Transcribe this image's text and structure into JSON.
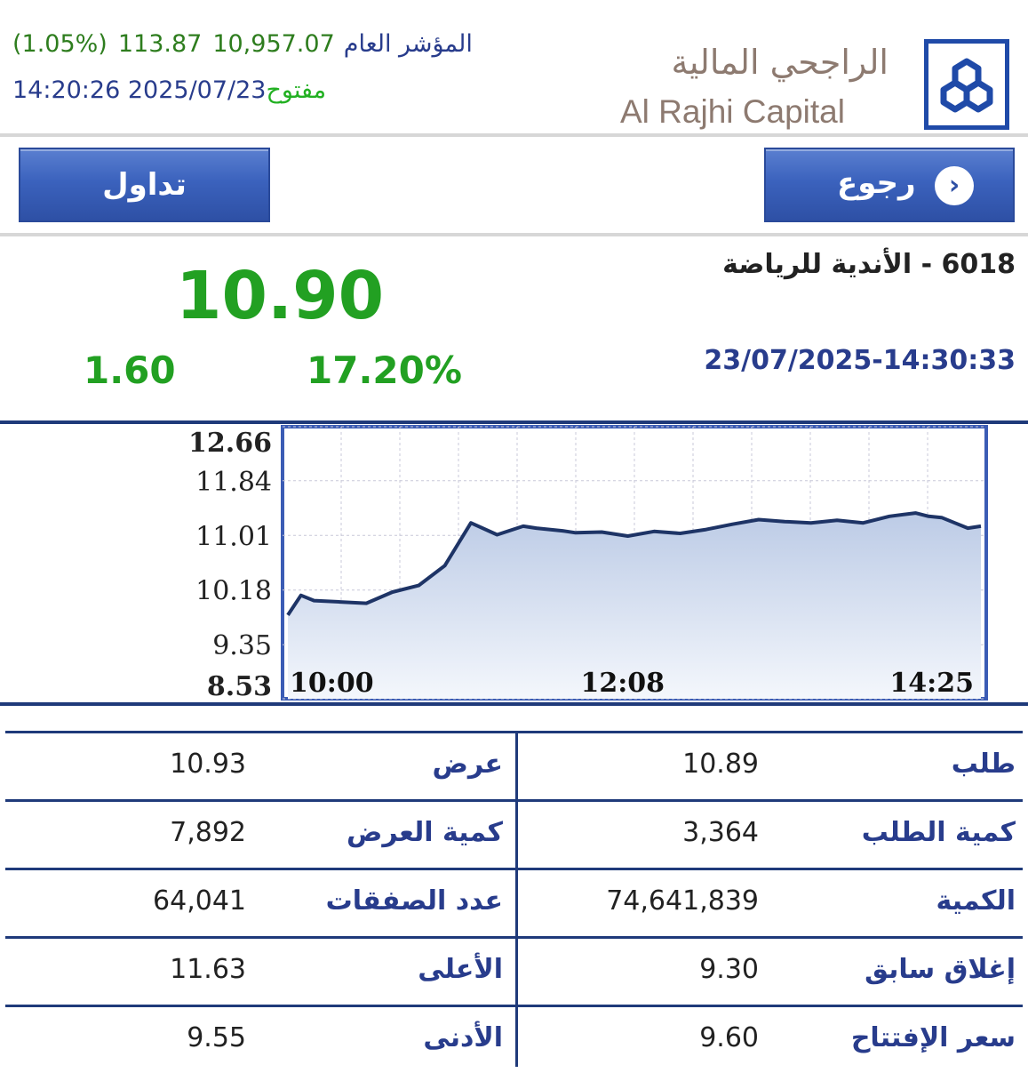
{
  "header": {
    "index_label": "المؤشر العام",
    "index_value": "10,957.07",
    "index_change": "113.87",
    "index_change_pct": "(1.05%)",
    "date_time": "2025/07/23 14:20:26",
    "market_status": "مفتوح",
    "brand_ar": "الراجحي المالية",
    "brand_en": "Al Rajhi Capital"
  },
  "nav": {
    "back_label": "رجوع",
    "back_icon": "chevron-right-icon",
    "trade_label": "تداول"
  },
  "stock": {
    "name": "6018 - الأندية للرياضة",
    "timestamp": "23/07/2025-14:30:33",
    "price": "10.90",
    "change": "1.60",
    "change_pct": "17.20%"
  },
  "colors": {
    "up": "#22a022",
    "navy": "#1f3a7a",
    "label": "#283c8c",
    "status_open": "#22b022"
  },
  "chart_data": {
    "type": "area",
    "y_ticks": [
      "12.66",
      "11.84",
      "11.01",
      "10.18",
      "9.35",
      "8.53"
    ],
    "x_ticks": [
      "10:00",
      "12:08",
      "14:25"
    ],
    "ylim": [
      8.53,
      12.66
    ],
    "grid": true,
    "series": [
      {
        "x": [
          "10:00",
          "10:05",
          "10:10",
          "10:20",
          "10:30",
          "10:40",
          "10:50",
          "11:00",
          "11:10",
          "11:20",
          "11:30",
          "11:35",
          "11:40",
          "11:45",
          "11:50",
          "12:00",
          "12:10",
          "12:20",
          "12:30",
          "12:40",
          "12:50",
          "13:00",
          "13:10",
          "13:20",
          "13:30",
          "13:40",
          "13:50",
          "14:00",
          "14:05",
          "14:10",
          "14:15",
          "14:20",
          "14:25"
        ],
        "values": [
          9.8,
          10.1,
          10.02,
          10.0,
          9.98,
          10.15,
          10.25,
          10.55,
          11.2,
          11.02,
          11.15,
          11.12,
          11.1,
          11.08,
          11.05,
          11.06,
          11.0,
          11.07,
          11.04,
          11.1,
          11.18,
          11.25,
          11.22,
          11.2,
          11.24,
          11.2,
          11.3,
          11.35,
          11.3,
          11.28,
          11.2,
          11.12,
          11.15
        ]
      }
    ]
  },
  "stats": [
    {
      "label_right": "طلب",
      "value_right": "10.89",
      "label_left": "عرض",
      "value_left": "10.93"
    },
    {
      "label_right": "كمية الطلب",
      "value_right": "3,364",
      "label_left": "كمية العرض",
      "value_left": "7,892"
    },
    {
      "label_right": "الكمية",
      "value_right": "74,641,839",
      "label_left": "عدد الصفقات",
      "value_left": "64,041"
    },
    {
      "label_right": "إغلاق سابق",
      "value_right": "9.30",
      "label_left": "الأعلى",
      "value_left": "11.63"
    },
    {
      "label_right": "سعر الإفتتاح",
      "value_right": "9.60",
      "label_left": "الأدنى",
      "value_left": "9.55"
    }
  ]
}
